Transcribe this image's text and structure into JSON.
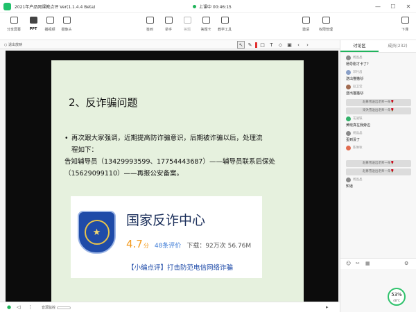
{
  "window": {
    "title": "2021年产品网课教点评 Ver(1.1.4.4 Beta)",
    "status": "上课中 00:46:15",
    "status_color": "#1fb45a"
  },
  "toolbar": {
    "left": [
      {
        "label": "分享屏幕",
        "icon": "monitor-icon"
      },
      {
        "label": "PPT",
        "icon": "ppt-icon",
        "active": true
      },
      {
        "label": "播视频",
        "icon": "video-play-icon"
      },
      {
        "label": "摄像头",
        "icon": "camera-icon"
      }
    ],
    "middle": [
      {
        "label": "签到",
        "icon": "checkin-icon"
      },
      {
        "label": "举手",
        "icon": "hand-icon"
      },
      {
        "label": "答题",
        "icon": "quiz-icon",
        "disabled": true
      },
      {
        "label": "答题卡",
        "icon": "answer-card-icon"
      },
      {
        "label": "教学工具",
        "icon": "teaching-tools-icon"
      }
    ],
    "right": [
      {
        "label": "邀请",
        "icon": "invite-icon"
      },
      {
        "label": "权限管理",
        "icon": "permission-icon"
      },
      {
        "label": "下课",
        "icon": "end-class-icon"
      }
    ]
  },
  "slide_bar": {
    "exit_label": "退出放映",
    "tools": [
      "cursor-icon",
      "pen-icon",
      "shape-icon",
      "text-icon",
      "eraser-icon",
      "save-icon",
      "prev-page-icon",
      "next-page-icon"
    ],
    "pen_color": "#e23030"
  },
  "slide": {
    "title": "2、反诈骗问题",
    "bullet": "再次跟大家强调，近期提高防诈骗意识，后期被诈骗以后，处理流",
    "bullet_cont": "程如下：",
    "line1": "告知辅导员（13429993599、17754443687）——辅导员联系后保处",
    "line2": "（15629099110）——再报公安备案。",
    "banner": {
      "app_name": "国家反诈中心",
      "score": "4.7",
      "score_unit": "分",
      "review_count": "48条评价",
      "downloads": "下载：92万次 56.76M",
      "review_line": "【小编点评】打击防范电信网络诈骗"
    }
  },
  "statusbar": {
    "audio_label": "音源监控"
  },
  "panel": {
    "tabs": [
      "讨论区",
      "成员(232)"
    ],
    "messages": [
      {
        "name": "杨晶晶",
        "text": "杨导刚才卡了?",
        "avatar": "#8a8a8a"
      },
      {
        "name": "邓竹昌",
        "text": "送出猫猫🐱",
        "avatar": "#8aa0c8"
      },
      {
        "name": "赵卫莹",
        "text": "送出猫猫🐱",
        "avatar": "#a06a50"
      }
    ],
    "system_1": "赵慕雪送出老师一朵🌹",
    "system_2": "梁洪雪送出老师一朵🌹",
    "messages_2": [
      {
        "name": "花凝铁",
        "text": "黄晓真在我旁边",
        "avatar": "#33b26a"
      },
      {
        "name": "杨晶晶",
        "text": "歪到没了",
        "avatar": "#8a8a8a"
      },
      {
        "name": "陈琳秋",
        "text": "",
        "avatar": "#e26b4f"
      }
    ],
    "system_3": "赵慕雪送出老师一朵🌹",
    "system_4": "赵慕雪送出老师一朵🌹",
    "messages_3": [
      {
        "name": "杨晶晶",
        "text": "知道",
        "avatar": "#8a8a8a"
      }
    ],
    "gauge_value": "53%",
    "gauge_temp": "48°C",
    "gauge_color": "#2fc26c"
  }
}
